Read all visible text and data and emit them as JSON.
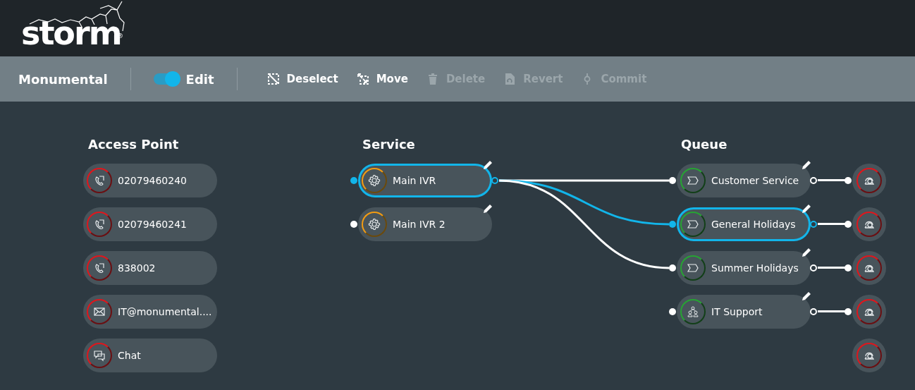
{
  "logo": {
    "text": "storm",
    "mark": "®"
  },
  "toolbar": {
    "title": "Monumental",
    "edit_toggle": {
      "label": "Edit",
      "on": true
    },
    "actions": [
      {
        "label": "Deselect",
        "kind": "deselect",
        "disabled": false
      },
      {
        "label": "Move",
        "kind": "move",
        "disabled": false
      },
      {
        "label": "Delete",
        "kind": "delete",
        "disabled": true
      },
      {
        "label": "Revert",
        "kind": "revert",
        "disabled": true
      },
      {
        "label": "Commit",
        "kind": "commit",
        "disabled": true
      }
    ]
  },
  "columns": [
    {
      "heading": "Access Point",
      "kind": "access_point",
      "nodes": [
        {
          "label": "02079460240",
          "kind": "phone",
          "selected": false
        },
        {
          "label": "02079460241",
          "kind": "phone",
          "selected": false
        },
        {
          "label": "838002",
          "kind": "phone",
          "selected": false
        },
        {
          "label": "IT@monumental....",
          "kind": "email",
          "selected": false
        },
        {
          "label": "Chat",
          "kind": "chat",
          "selected": false
        }
      ]
    },
    {
      "heading": "Service",
      "kind": "service",
      "nodes": [
        {
          "label": "Main IVR",
          "kind": "ivr",
          "selected": true,
          "outbound": true
        },
        {
          "label": "Main IVR 2",
          "kind": "ivr",
          "selected": false,
          "outbound": false
        }
      ]
    },
    {
      "heading": "Queue",
      "kind": "queue",
      "nodes": [
        {
          "label": "Customer Service",
          "kind": "queue",
          "selected": false,
          "inbound": true
        },
        {
          "label": "General Holidays",
          "kind": "queue",
          "selected": true,
          "inbound": true
        },
        {
          "label": "Summer Holidays",
          "kind": "queue",
          "selected": false,
          "inbound": true
        },
        {
          "label": "IT Support",
          "kind": "group",
          "selected": false,
          "inbound": false
        }
      ]
    }
  ],
  "endpoints": [
    {
      "linked": true
    },
    {
      "linked": true
    },
    {
      "linked": true
    },
    {
      "linked": true
    },
    {
      "linked": false
    }
  ]
}
